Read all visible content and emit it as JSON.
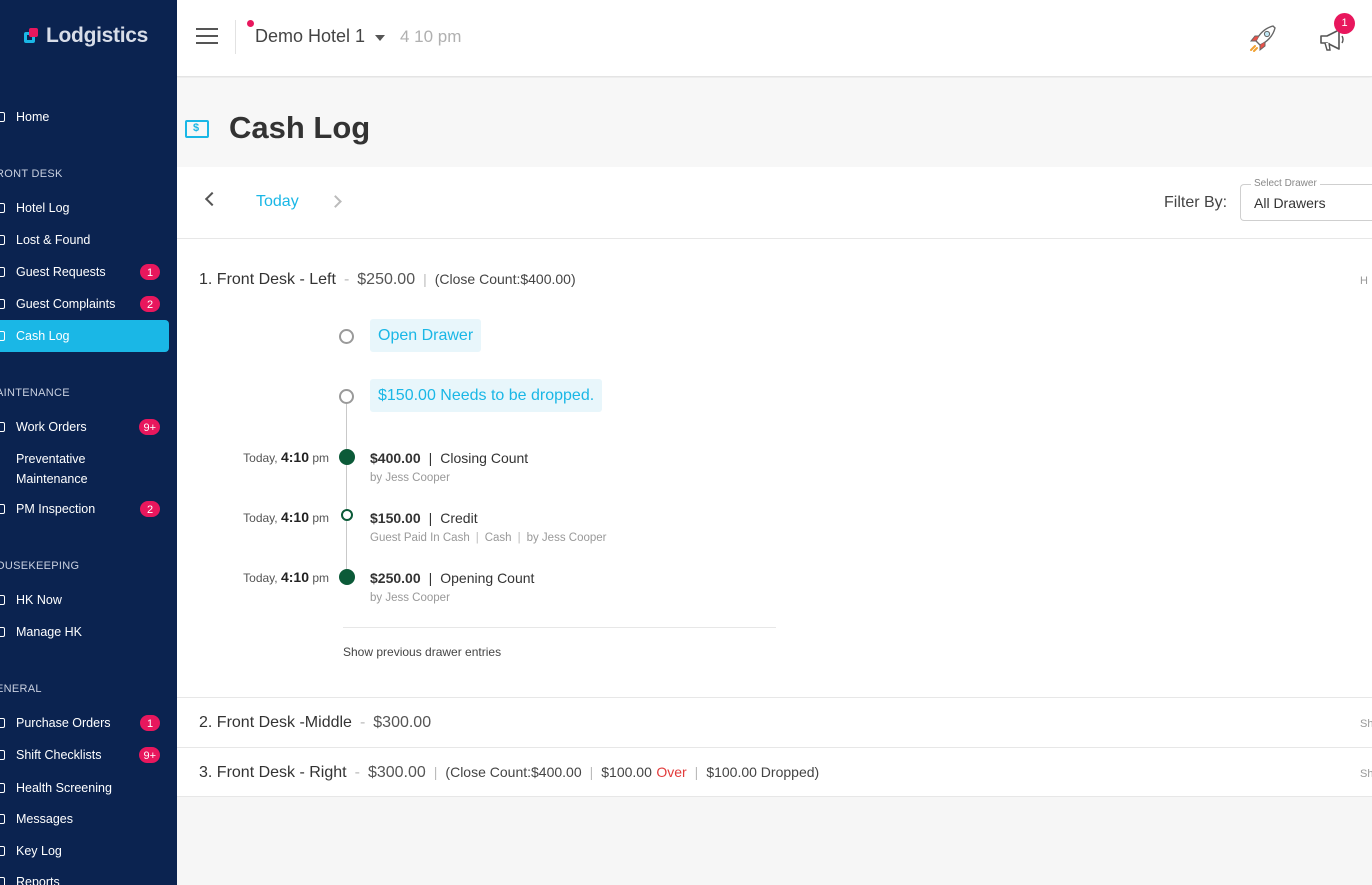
{
  "app": {
    "logo": "Lodgistics"
  },
  "sidebar": {
    "home": "Home",
    "sections": {
      "front_desk": "RONT DESK",
      "maintenance": "AINTENANCE",
      "housekeeping": "OUSEKEEPING",
      "general": "ENERAL"
    },
    "items": {
      "hotel_log": "Hotel Log",
      "lost_found": "Lost & Found",
      "guest_requests": {
        "label": "Guest Requests",
        "badge": "1"
      },
      "guest_complaints": {
        "label": "Guest Complaints",
        "badge": "2"
      },
      "cash_log": "Cash Log",
      "work_orders": {
        "label": "Work Orders",
        "badge": "9+"
      },
      "preventative_1": "Preventative",
      "preventative_2": "Maintenance",
      "pm_inspection": {
        "label": "PM Inspection",
        "badge": "2"
      },
      "hk_now": "HK Now",
      "manage_hk": "Manage HK",
      "purchase_orders": {
        "label": "Purchase Orders",
        "badge": "1"
      },
      "shift_checklists": {
        "label": "Shift Checklists",
        "badge": "9+"
      },
      "health_screening": "Health Screening",
      "messages": "Messages",
      "key_log": "Key Log",
      "reports": "Reports"
    }
  },
  "header": {
    "hotel": "Demo Hotel 1",
    "time": "4 10 pm",
    "notifications": "1"
  },
  "page": {
    "title": "Cash Log"
  },
  "toolbar": {
    "date": "Today",
    "filter_label": "Filter By:",
    "select_legend": "Select Drawer",
    "select_value": "All Drawers"
  },
  "drawers": [
    {
      "name": "1. Front Desk - Left",
      "amount": "$250.00",
      "close_count": "(Close Count:$400.00)",
      "cut": "H",
      "tags": [
        "Open Drawer",
        "$150.00 Needs to be dropped."
      ],
      "entries": [
        {
          "day": "Today,",
          "time": "4:10",
          "ampm": "pm",
          "amount": "$400.00",
          "type": "Closing Count",
          "sub": [
            "by Jess Cooper"
          ]
        },
        {
          "day": "Today,",
          "time": "4:10",
          "ampm": "pm",
          "amount": "$150.00",
          "type": "Credit",
          "sub": [
            "Guest Paid In Cash",
            "Cash",
            "by Jess Cooper"
          ]
        },
        {
          "day": "Today,",
          "time": "4:10",
          "ampm": "pm",
          "amount": "$250.00",
          "type": "Opening Count",
          "sub": [
            "by Jess Cooper"
          ]
        }
      ],
      "show_previous": "Show previous drawer entries"
    },
    {
      "name": "2. Front Desk -Middle",
      "amount": "$300.00",
      "cut": "Sh"
    },
    {
      "name": "3. Front Desk - Right",
      "amount": "$300.00",
      "close_count": "(Close Count:$400.00",
      "over_amount": "$100.00",
      "over_label": "Over",
      "dropped": "$100.00 Dropped)",
      "cut": "Sh"
    }
  ],
  "colors": {
    "accent": "#1ab7e6",
    "sidebar": "#0b2350",
    "badge": "#e8175d",
    "dot": "#0b5a38",
    "over": "#e23b3b"
  }
}
